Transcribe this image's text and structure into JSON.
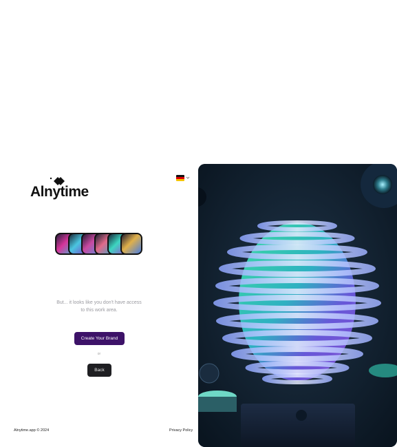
{
  "brand": {
    "name": "Alnytime"
  },
  "language": {
    "selected": "de",
    "icon": "germany-flag-icon"
  },
  "avatars": [
    "avatar-1",
    "avatar-2",
    "avatar-3",
    "avatar-4",
    "avatar-5",
    "avatar-6"
  ],
  "message": {
    "line1": "But... it looks like you don't have access",
    "line2": "to this work area."
  },
  "actions": {
    "create_brand": "Create Your Brand",
    "or": "or",
    "back": "Back"
  },
  "footer": {
    "copyright": "Alnytime.app © 2024",
    "privacy": "Privacy Policy"
  },
  "colors": {
    "primary_button": "#3d1268",
    "back_button": "#1f1f22",
    "hero_background": "#0f1c2a"
  }
}
